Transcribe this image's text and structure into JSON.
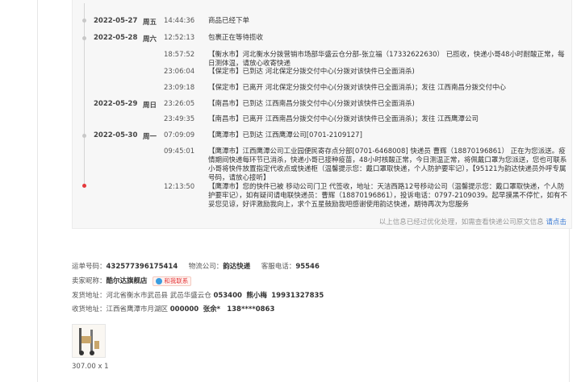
{
  "tracking": [
    {
      "date": "2022-05-27",
      "weekday": "周五",
      "time": "14:44:36",
      "text": "商品已经下单"
    },
    {
      "date": "2022-05-28",
      "weekday": "周六",
      "time": "12:52:13",
      "text": "包裹正在等待揽收"
    },
    {
      "date": "",
      "weekday": "",
      "time": "18:57:52",
      "text": "【衡水市】河北衡水分拨营销市场部华盛云仓分部-张立福（17332622630） 已揽收，快递小哥48小时耐酸正常，每日测体温，请放心收寄快递"
    },
    {
      "date": "",
      "weekday": "",
      "time": "23:06:04",
      "text": "【保定市】已到达 河北保定分拨交付中心(分拨对该快件已全面消杀)"
    },
    {
      "date": "",
      "weekday": "",
      "time": "23:09:18",
      "text": "【保定市】已离开 河北保定分拨交付中心(分拨对该快件已全面消杀)；发往 江西南昌分拨交付中心"
    },
    {
      "date": "2022-05-29",
      "weekday": "周日",
      "time": "23:26:05",
      "text": "【南昌市】已到达 江西南昌分拨交付中心(分拨对该快件已全面消杀)"
    },
    {
      "date": "",
      "weekday": "",
      "time": "23:49:35",
      "text": "【南昌市】已离开 江西南昌分拨交付中心(分拨对该快件已全面消杀)；发往 江西鹰潭公司"
    },
    {
      "date": "2022-05-30",
      "weekday": "周一",
      "time": "07:09:09",
      "text": "【鹰潭市】已到达 江西鹰潭公司[0701-2109127]"
    },
    {
      "date": "",
      "weekday": "",
      "time": "09:45:01",
      "text": "【鹰潭市】江西鹰潭公司工业园便民寄存点分部[0701-6468008] 快递员 曹辉（18870196861） 正在为您派送。疫情期间快递每环节已消杀，快递小哥已接种疫苗，48小时核酸正常，今日测温正常，将佩戴口罩为您派送，您也可联系小哥将快件放置指定代收点或快递柜（温馨提示您：戴口罩取快递，个人防护要牢记），【95121为韵达快递员外呼专属号码，请放心接听】"
    },
    {
      "date": "",
      "weekday": "",
      "time": "12:13:50",
      "text": "【鹰潭市】您的快件已被 移动公司门卫 代签收，地址：天洁西路12号移动公司（温馨提示您：戴口罩取快递，个人防护要牢记），如有疑问请电联快递员：曹辉（18870196861），投诉电话：0797-2109039。起早摸黑不停忙，如有不妥您见谅，好评激励我向上，求个五星鼓励我吧感谢使用韵达快递，期待再次为您服务"
    }
  ],
  "footnote": {
    "text": "以上信息已经过优化处理，如需查看快递公司原文信息",
    "link": "请点击"
  },
  "order": {
    "waybill_label": "运单号码：",
    "waybill": "432577396175414",
    "carrier_label": "物流公司：",
    "carrier": "韵达快递",
    "service_label": "客服电话：",
    "service": "95546",
    "seller_label": "卖家昵称：",
    "seller": "酷尔达旗舰店",
    "contact": "和我联系",
    "ship_label": "发货地址：",
    "ship_addr": "河北省衡水市武邑县 武邑华盛云仓",
    "ship_zip": "053400",
    "ship_name": "熊小梅",
    "ship_phone": "19931327835",
    "recv_label": "收货地址：",
    "recv_addr": "江西省鹰潭市月湖区",
    "recv_zip": "000000",
    "recv_name": "张余*",
    "recv_phone": "138****0863"
  },
  "product": {
    "price": "307.00 x 1"
  },
  "colors": {
    "accent": "#e4393c",
    "link": "#3a7bd5"
  }
}
